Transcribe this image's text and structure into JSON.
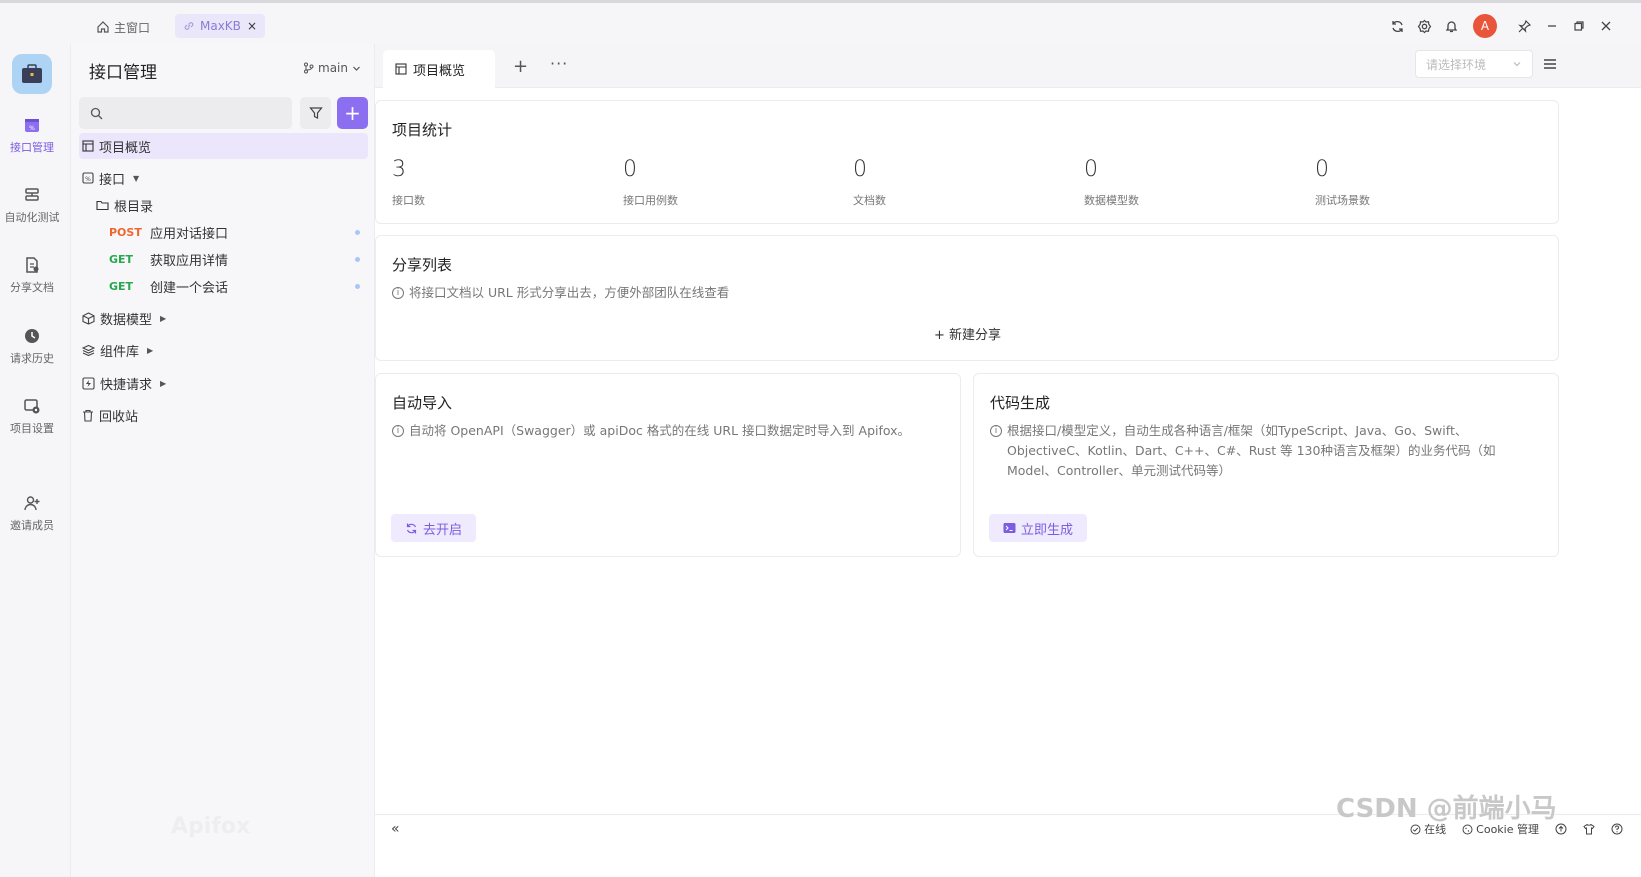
{
  "titlebar": {
    "home_tab": "主窗口",
    "active_tab": "MaxKB",
    "close_glyph": "×",
    "logo_letter": "A"
  },
  "rail": {
    "items": [
      {
        "label": "接口管理",
        "icon": "api-icon"
      },
      {
        "label": "自动化测试",
        "icon": "automation-icon"
      },
      {
        "label": "分享文档",
        "icon": "share-doc-icon"
      },
      {
        "label": "请求历史",
        "icon": "history-icon"
      },
      {
        "label": "项目设置",
        "icon": "settings-icon"
      },
      {
        "label": "邀请成员",
        "icon": "invite-icon"
      }
    ]
  },
  "sidebar": {
    "title": "接口管理",
    "branch": "main",
    "search_placeholder": "",
    "add_glyph": "+",
    "tree": {
      "overview": "项目概览",
      "api": "接口",
      "root": "根目录",
      "endpoints": [
        {
          "method": "POST",
          "name": "应用对话接口"
        },
        {
          "method": "GET",
          "name": "获取应用详情"
        },
        {
          "method": "GET",
          "name": "创建一个会话"
        }
      ],
      "models": "数据模型",
      "components": "组件库",
      "quick": "快捷请求",
      "trash": "回收站"
    },
    "watermark": "Apifox"
  },
  "main": {
    "tab_label": "项目概览",
    "add_tab": "+",
    "more_tab": "···",
    "env_placeholder": "请选择环境",
    "stats": {
      "title": "项目统计",
      "items": [
        {
          "value": "3",
          "label": "接口数"
        },
        {
          "value": "0",
          "label": "接口用例数"
        },
        {
          "value": "0",
          "label": "文档数"
        },
        {
          "value": "0",
          "label": "数据模型数"
        },
        {
          "value": "0",
          "label": "测试场景数"
        }
      ]
    },
    "share": {
      "title": "分享列表",
      "desc": "将接口文档以 URL 形式分享出去，方便外部团队在线查看",
      "new_button": "+ 新建分享"
    },
    "import": {
      "title": "自动导入",
      "desc": "自动将 OpenAPI（Swagger）或 apiDoc 格式的在线 URL 接口数据定时导入到 Apifox。",
      "button": "去开启"
    },
    "codegen": {
      "title": "代码生成",
      "desc": "根据接口/模型定义，自动生成各种语言/框架（如TypeScript、Java、Go、Swift、ObjectiveC、Kotlin、Dart、C++、C#、Rust 等 130种语言及框架）的业务代码（如 Model、Controller、单元测试代码等）",
      "button": "立即生成"
    }
  },
  "footer": {
    "collapse": "«",
    "online": "在线",
    "cookie": "Cookie 管理"
  },
  "watermark_csdn": "CSDN @前端小马",
  "colors": {
    "accent": "#8c6ff0",
    "post": "#f0662d",
    "get": "#27a84e"
  }
}
